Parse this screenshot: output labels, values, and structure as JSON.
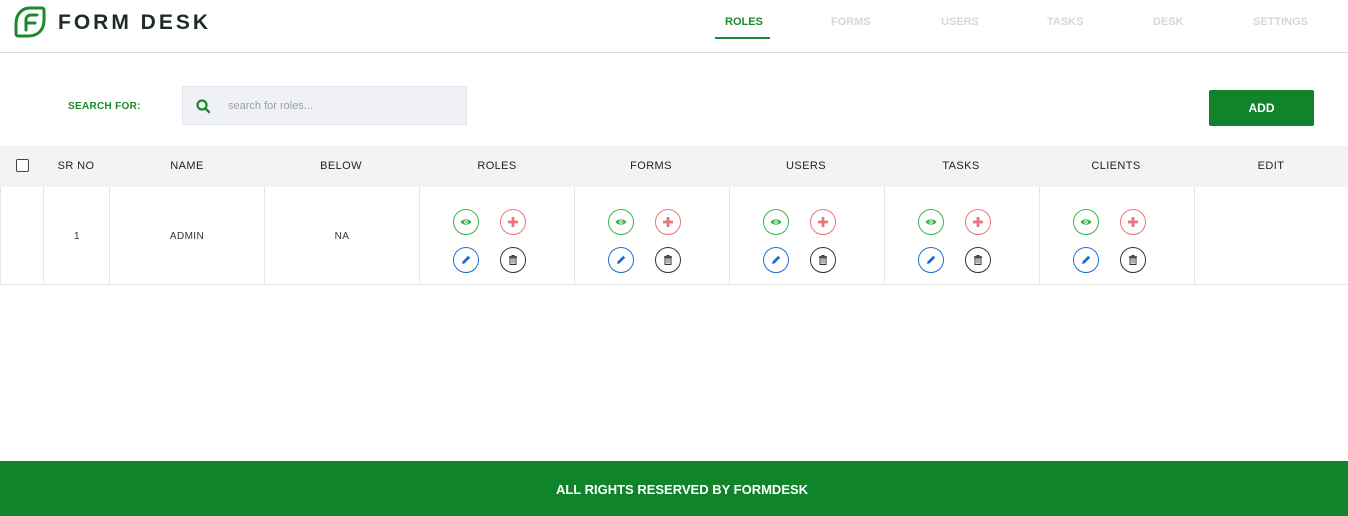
{
  "brand": {
    "name": "FORM DESK"
  },
  "nav": [
    {
      "label": "ROLES",
      "active": true
    },
    {
      "label": "FORMS",
      "active": false
    },
    {
      "label": "USERS",
      "active": false
    },
    {
      "label": "TASKS",
      "active": false
    },
    {
      "label": "DESK",
      "active": false
    },
    {
      "label": "SETTINGS",
      "active": false
    }
  ],
  "search": {
    "label": "SEARCH FOR:",
    "placeholder": "search for roles...",
    "value": "",
    "icon": "search-icon"
  },
  "add_button": {
    "label": "ADD"
  },
  "table": {
    "columns": [
      "SR NO",
      "NAME",
      "BELOW",
      "ROLES",
      "FORMS",
      "USERS",
      "TASKS",
      "CLIENTS",
      "EDIT"
    ],
    "rows": [
      {
        "sr_no": "1",
        "name": "ADMIN",
        "below": "NA",
        "permissions": [
          "roles",
          "forms",
          "users",
          "tasks",
          "clients"
        ]
      }
    ],
    "permission_actions": [
      "view",
      "add",
      "edit",
      "delete"
    ]
  },
  "colors": {
    "accent": "#10842a",
    "view": "#3cb54a",
    "add": "#e8767a",
    "edit": "#1c6fd1",
    "delete": "#333333"
  },
  "footer": {
    "text": "ALL RIGHTS RESERVED BY FORMDESK"
  }
}
